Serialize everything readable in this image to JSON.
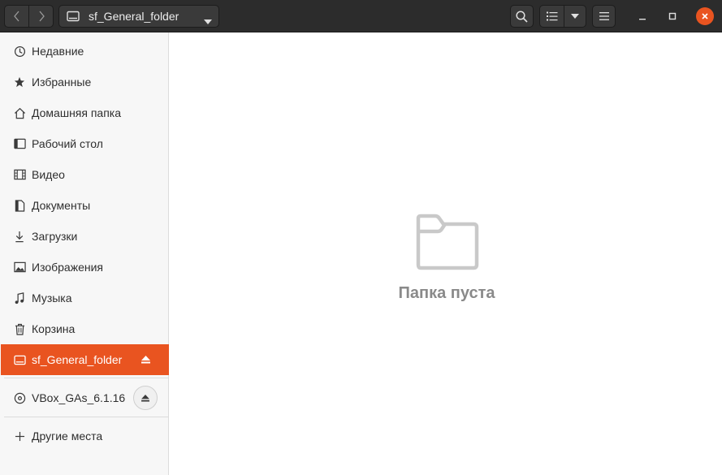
{
  "header": {
    "path_label": "sf_General_folder",
    "icons": {
      "back": "chevron-left-icon",
      "forward": "chevron-right-icon",
      "drive": "drive-icon",
      "search": "search-icon",
      "view": "list-view-icon",
      "menu": "hamburger-menu-icon",
      "minimize": "minimize-icon",
      "maximize": "maximize-icon",
      "close": "close-icon"
    }
  },
  "sidebar": {
    "items": [
      {
        "label": "Недавние",
        "icon": "recent-icon"
      },
      {
        "label": "Избранные",
        "icon": "star-icon"
      },
      {
        "label": "Домашняя папка",
        "icon": "home-icon"
      },
      {
        "label": "Рабочий стол",
        "icon": "desktop-icon"
      },
      {
        "label": "Видео",
        "icon": "video-icon"
      },
      {
        "label": "Документы",
        "icon": "document-icon"
      },
      {
        "label": "Загрузки",
        "icon": "download-icon"
      },
      {
        "label": "Изображения",
        "icon": "image-icon"
      },
      {
        "label": "Музыка",
        "icon": "music-icon"
      },
      {
        "label": "Корзина",
        "icon": "trash-icon"
      },
      {
        "label": "sf_General_folder",
        "icon": "drive-icon",
        "active": true
      }
    ],
    "devices": [
      {
        "label": "VBox_GAs_6.1.16",
        "icon": "disc-icon"
      }
    ],
    "other_locations": {
      "label": "Другие места",
      "icon": "plus-icon"
    }
  },
  "main": {
    "empty_text": "Папка пуста",
    "empty_icon": "folder-icon"
  },
  "colors": {
    "accent": "#e95420",
    "header_bg": "#2c2c2c",
    "sidebar_bg": "#f7f7f7",
    "empty_text": "#8a8a8a"
  }
}
